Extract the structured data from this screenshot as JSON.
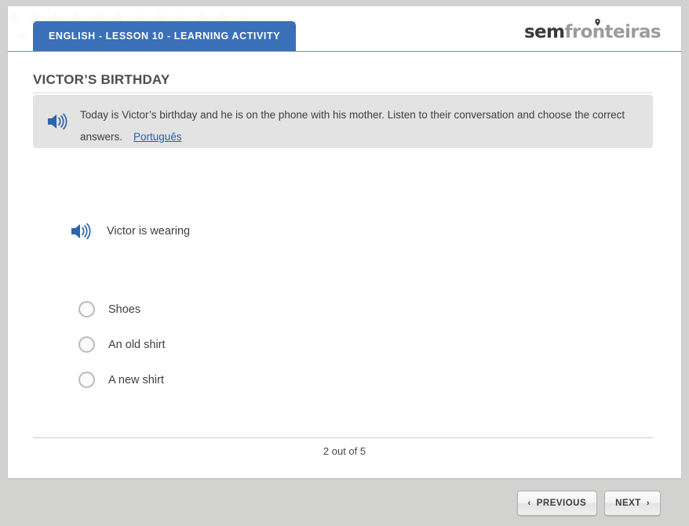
{
  "header": {
    "tab_label": "ENGLISH - LESSON 10 - LEARNING ACTIVITY",
    "logo_first": "sem",
    "logo_second": "fronteiras",
    "logo_pin_icon": "map-pin-icon",
    "tab_color": "#3a70b8",
    "watermark_glyphs": "⌖⌖⌖⌖⌖⌖⌖⌖⌖⌖⌖⌖"
  },
  "activity": {
    "title": "VICTOR’S BIRTHDAY",
    "instruction_icon": "speaker-icon",
    "instruction_text": "Today is Victor’s birthday and he is on the phone with his mother. Listen to their conversation and choose the correct answers.",
    "instruction_link": "Português",
    "link_color": "#2a5db0"
  },
  "question": {
    "audio_icon": "speaker-icon",
    "text": "Victor is wearing",
    "options": [
      {
        "label": "Shoes",
        "selected": false
      },
      {
        "label": "An old shirt",
        "selected": false
      },
      {
        "label": "A new shirt",
        "selected": false
      }
    ]
  },
  "footer": {
    "progress": "2 out of 5"
  },
  "navigation": {
    "previous_label": "PREVIOUS",
    "next_label": "NEXT",
    "previous_chevron": "‹",
    "next_chevron": "›"
  }
}
